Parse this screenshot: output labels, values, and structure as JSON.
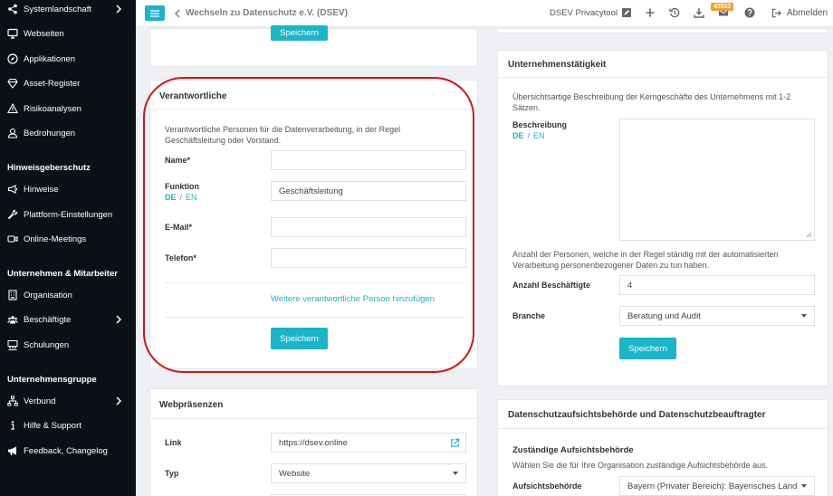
{
  "sidebar": {
    "items": [
      {
        "label": "Systemlandschaft",
        "icon": "share-nodes-icon",
        "chevron": true
      },
      {
        "label": "Webseiten",
        "icon": "monitor-icon"
      },
      {
        "label": "Applikationen",
        "icon": "compass-icon"
      },
      {
        "label": "Asset-Register",
        "icon": "diamond-icon"
      },
      {
        "label": "Risikoanalysen",
        "icon": "warning-icon"
      },
      {
        "label": "Bedrohungen",
        "icon": "user-threat-icon"
      }
    ],
    "section_hinweis": "Hinweisgeberschutz",
    "items2": [
      {
        "label": "Hinweise",
        "icon": "megaphone-icon"
      },
      {
        "label": "Plattform-Einstellungen",
        "icon": "wrench-icon"
      },
      {
        "label": "Online-Meetings",
        "icon": "video-icon"
      }
    ],
    "section_unternehmen": "Unternehmen & Mitarbeiter",
    "items3": [
      {
        "label": "Organisation",
        "icon": "building-icon"
      },
      {
        "label": "Beschäftigte",
        "icon": "users-icon",
        "chevron": true
      },
      {
        "label": "Schulungen",
        "icon": "training-icon"
      }
    ],
    "section_gruppe": "Unternehmensgruppe",
    "items4": [
      {
        "label": "Verbund",
        "icon": "org-chart-icon",
        "chevron": true
      },
      {
        "label": "Hilfe & Support",
        "icon": "info-icon"
      },
      {
        "label": "Feedback, Changelog",
        "icon": "bullhorn-icon"
      }
    ]
  },
  "topbar": {
    "back_label": "Wechseln zu Datenschutz e.V. (DSEV)",
    "app_name": "DSEV Privacytool",
    "badge": "43532",
    "logout": "Abmelden"
  },
  "verantwortliche": {
    "title": "Verantwortliche",
    "description_line1": "Verantwortliche Personen für die Datenverarbeitung, in der Regel",
    "description_line2": "Geschäftsleitung oder Vorstand.",
    "name_label": "Name*",
    "name_value": "",
    "funktion_label": "Funktion",
    "funktion_value": "Geschäftsleitung",
    "email_label": "E-Mail*",
    "email_value": "",
    "telefon_label": "Telefon*",
    "telefon_value": "",
    "add_link": "Weitere verantwortliche Person hinzufügen",
    "save": "Speichern"
  },
  "lang": {
    "de": "DE",
    "slash": "/",
    "en": "EN"
  },
  "top_card": {
    "save": "Speichern"
  },
  "webpraesenzen": {
    "title": "Webpräsenzen",
    "link_label": "Link",
    "link_value": "https://dsev.online",
    "typ_label": "Typ",
    "typ_value": "Website"
  },
  "taetigkeit": {
    "title": "Unternehmenstätigkeit",
    "description_line1": "Übersichtsartige Beschreibung der Kerngeschäfte des Unternehmens mit 1-2",
    "description_line2": "Sätzen.",
    "beschreibung_label": "Beschreibung",
    "anzahl_desc_line1": "Anzahl der Personen, welche in der Regel ständig mit der automatisierten",
    "anzahl_desc_line2": "Verarbeitung personenbezogener Daten zu tun haben.",
    "anzahl_label": "Anzahl Beschäftigte",
    "anzahl_value": "4",
    "branche_label": "Branche",
    "branche_value": "Beratung und Audit",
    "save": "Speichern"
  },
  "aufsicht": {
    "title": "Datenschutzaufsichtsbehörde und Datenschutzbeauftragter",
    "subtitle": "Zuständige Aufsichtsbehörde",
    "description": "Wählen Sie die für Ihre Organisation zuständige Aufsichtsbehörde aus.",
    "behoerde_label": "Aufsichtsbehörde",
    "behoerde_value": "Bayern (Privater Bereich): Bayerisches Land"
  },
  "colors": {
    "accent": "#1ab5c9",
    "sidebar_bg": "#0b1017",
    "highlight": "#d0141c",
    "badge": "#f0a030"
  }
}
